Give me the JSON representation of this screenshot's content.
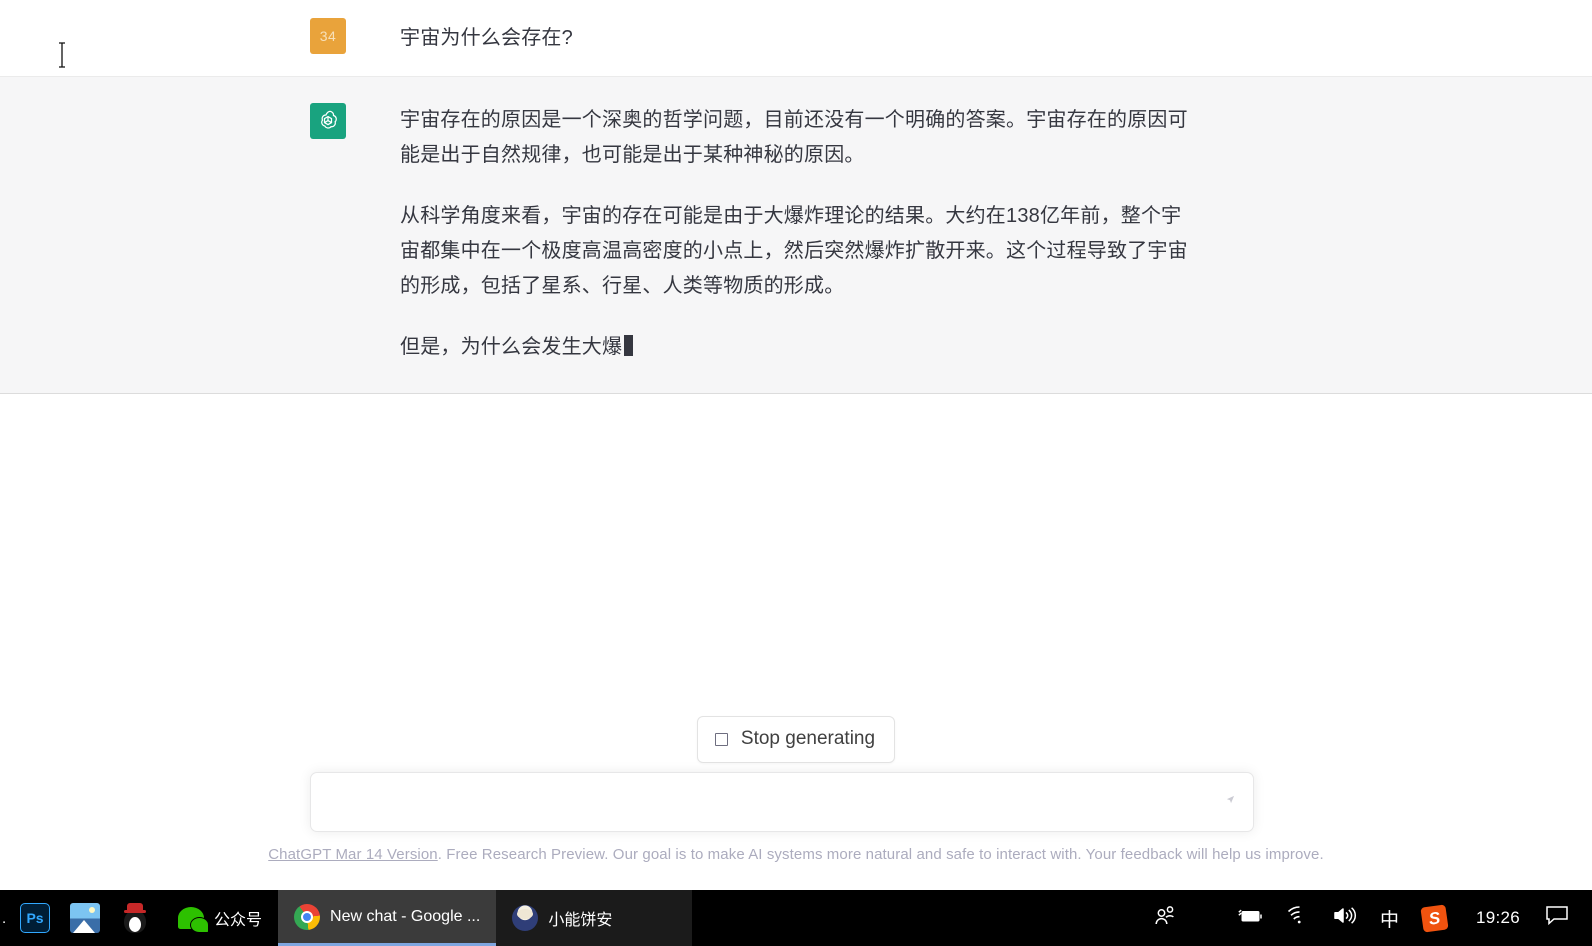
{
  "conversation": {
    "messages": [
      {
        "role": "user",
        "avatar_label": "34",
        "avatar_color": "#e9a33b",
        "paragraphs": [
          "宇宙为什么会存在?"
        ]
      },
      {
        "role": "assistant",
        "avatar_icon": "openai-logo-icon",
        "avatar_color": "#19a37f",
        "paragraphs": [
          "宇宙存在的原因是一个深奥的哲学问题，目前还没有一个明确的答案。宇宙存在的原因可能是出于自然规律，也可能是出于某种神秘的原因。",
          "从科学角度来看，宇宙的存在可能是由于大爆炸理论的结果。大约在138亿年前，整个宇宙都集中在一个极度高温高密度的小点上，然后突然爆炸扩散开来。这个过程导致了宇宙的形成，包括了星系、行星、人类等物质的形成。",
          "但是，为什么会发生大爆"
        ],
        "streaming": true
      }
    ]
  },
  "stop_button": {
    "label": "Stop generating",
    "icon": "stop-square-icon"
  },
  "composer": {
    "value": "",
    "placeholder": "",
    "send_icon": "send-icon"
  },
  "footer": {
    "link_text": "ChatGPT Mar 14 Version",
    "rest_text": ". Free Research Preview. Our goal is to make AI systems more natural and safe to interact with. Your feedback will help us improve."
  },
  "taskbar": {
    "start_dot": ".",
    "apps": [
      {
        "name": "photoshop",
        "icon": "photoshop-icon",
        "label": ""
      },
      {
        "name": "photos",
        "icon": "photos-icon",
        "label": ""
      },
      {
        "name": "qq",
        "icon": "qq-penguin-icon",
        "label": ""
      },
      {
        "name": "wechat",
        "icon": "wechat-icon",
        "label": "公众号"
      }
    ],
    "windows": [
      {
        "name": "chrome-window",
        "icon": "chrome-icon",
        "label": "New chat - Google ...",
        "active": true
      },
      {
        "name": "qq-chat-window",
        "icon": "qq-avatar-icon",
        "label": "小能饼安",
        "active": false
      }
    ],
    "tray": {
      "people_icon": "people-icon",
      "battery_icon": "battery-charging-icon",
      "wifi_icon": "wifi-icon",
      "volume_icon": "volume-icon",
      "ime_label": "中",
      "sogou_label": "S",
      "clock": "19:26",
      "notification_icon": "notification-icon"
    }
  }
}
